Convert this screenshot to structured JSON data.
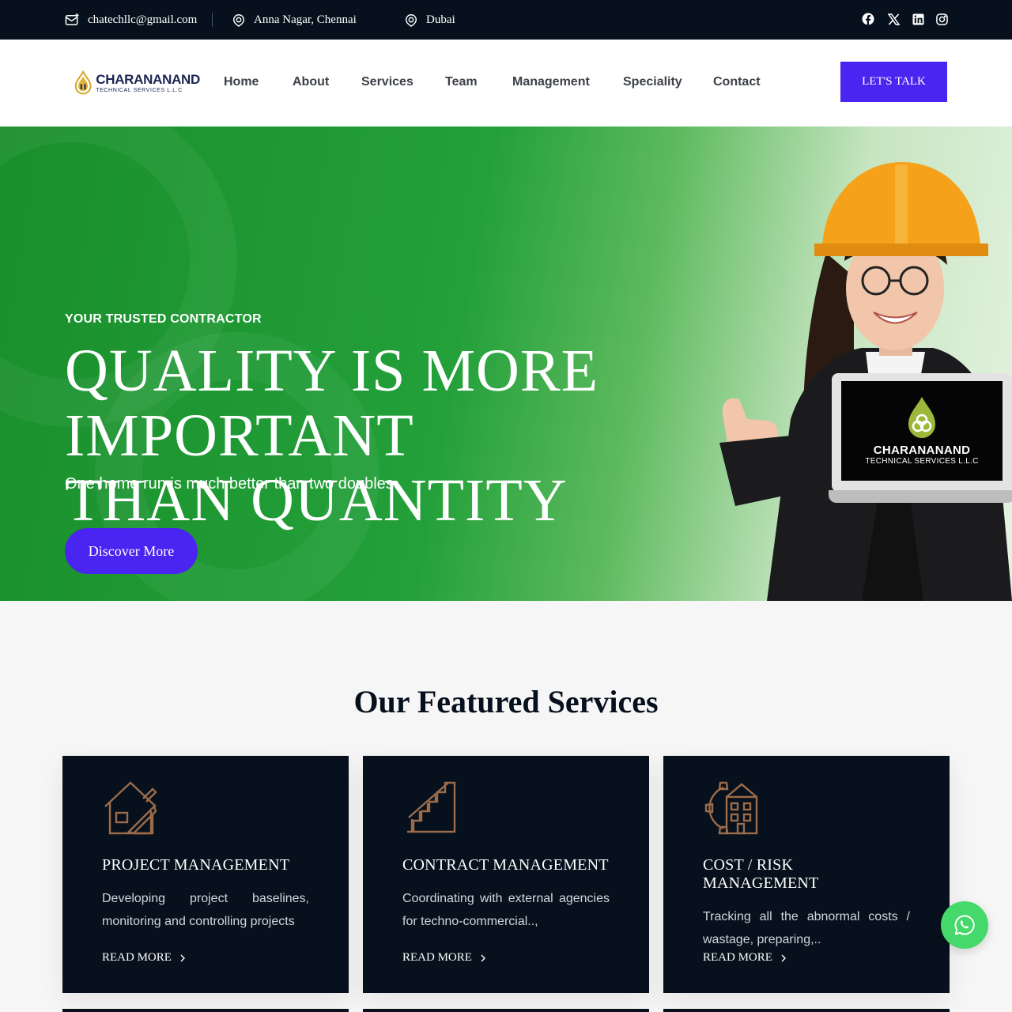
{
  "topbar": {
    "email": "chatechllc@gmail.com",
    "location1": "Anna Nagar, Chennai",
    "location2": "Dubai",
    "social": [
      "facebook-icon",
      "x-icon",
      "linkedin-icon",
      "instagram-icon"
    ]
  },
  "header": {
    "logo": {
      "brand": "CHARANANAND",
      "sub": "TECHNICAL SERVICES L.L.C"
    },
    "nav": [
      "Home",
      "About",
      "Services",
      "Team",
      "Management",
      "Speciality",
      "Contact"
    ],
    "cta_label": "LET'S TALK"
  },
  "hero": {
    "tagline": "YOUR TRUSTED CONTRACTOR",
    "title_line1": "QUALITY IS MORE IMPORTANT",
    "title_line2": "THAN QUANTITY",
    "subtitle": "One home run is much better than two doubles",
    "button_label": "Discover More",
    "laptop_brand": "CHARANANAND",
    "laptop_sub": "TECHNICAL SERVICES L.L.C"
  },
  "services": {
    "title": "Our Featured Services",
    "cards": [
      {
        "icon": "house-blueprint-icon",
        "title": "PROJECT MANAGEMENT",
        "text": "Developing project baselines, monitoring and controlling projects",
        "link": "READ MORE"
      },
      {
        "icon": "stairs-icon",
        "title": "CONTRACT MANAGEMENT",
        "text": "Coordinating with external agencies for techno-commercial..,",
        "link": "READ MORE"
      },
      {
        "icon": "building-gear-icon",
        "title": "COST / RISK MANAGEMENT",
        "text": "Tracking all the abnormal costs / wastage, preparing,..",
        "link": "READ MORE"
      }
    ]
  },
  "colors": {
    "dark": "#06111d",
    "accent": "#4a24f0",
    "icon_brown": "#9c6b4a",
    "whatsapp": "#45d86a",
    "hero_green": "#23a03a"
  },
  "floating": {
    "icon": "whatsapp-icon"
  }
}
